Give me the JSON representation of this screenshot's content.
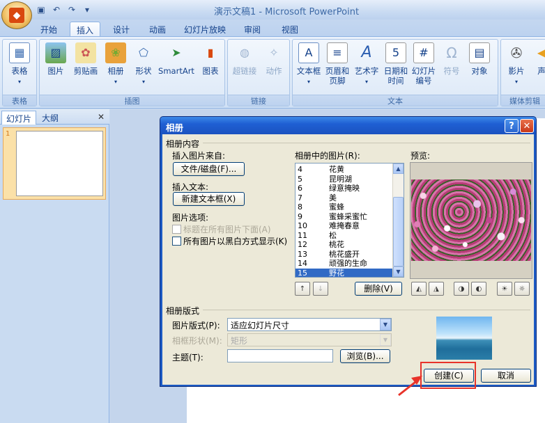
{
  "window": {
    "title": "演示文稿1 - Microsoft PowerPoint"
  },
  "quick_access": {
    "save_icon": "save-icon",
    "undo_icon": "undo-icon",
    "redo_icon": "redo-icon"
  },
  "ribbon_tabs": [
    "开始",
    "插入",
    "设计",
    "动画",
    "幻灯片放映",
    "审阅",
    "视图"
  ],
  "active_tab": "插入",
  "ribbon": {
    "groups": {
      "table": "表格",
      "illustrations": "插图",
      "links": "链接",
      "text": "文本",
      "media": "媒体剪辑"
    },
    "buttons": {
      "table": "表格",
      "picture": "图片",
      "clipart": "剪贴画",
      "album": "相册",
      "shapes": "形状",
      "smartart": "SmartArt",
      "chart": "图表",
      "hyperlink": "超链接",
      "action": "动作",
      "textbox": "文本框",
      "header_footer_1": "页眉和",
      "header_footer_2": "页脚",
      "wordart": "艺术字",
      "datetime_1": "日期和",
      "datetime_2": "时间",
      "slide_num_1": "幻灯片",
      "slide_num_2": "编号",
      "symbol": "符号",
      "object": "对象",
      "movie": "影片",
      "sound": "声"
    }
  },
  "panel_tabs": {
    "slides": "幻灯片",
    "outline": "大纲",
    "close": "✕"
  },
  "slide_thumb": {
    "number": "1"
  },
  "dialog": {
    "title": "相册",
    "help": "?",
    "close": "✕",
    "content_section": "相册内容",
    "insert_from_label": "插入图片来自:",
    "file_disk_button": "文件/磁盘(F)...",
    "insert_text_label": "插入文本:",
    "new_textbox_button": "新建文本框(X)",
    "picture_options_label": "图片选项:",
    "captions_below": "标题在所有图片下面(A)",
    "all_bw": "所有图片以黑白方式显示(K)",
    "pictures_in_album_label": "相册中的图片(R):",
    "pictures": [
      {
        "num": "4",
        "name": "花黄"
      },
      {
        "num": "5",
        "name": "昆明湖"
      },
      {
        "num": "6",
        "name": "绿意掩映"
      },
      {
        "num": "7",
        "name": "美"
      },
      {
        "num": "8",
        "name": "蜜蜂"
      },
      {
        "num": "9",
        "name": "蜜蜂采蜜忙"
      },
      {
        "num": "10",
        "name": "难掩春意"
      },
      {
        "num": "11",
        "name": "松"
      },
      {
        "num": "12",
        "name": "桃花"
      },
      {
        "num": "13",
        "name": "桃花盛开"
      },
      {
        "num": "14",
        "name": "顽强的生命"
      },
      {
        "num": "15",
        "name": "野花"
      }
    ],
    "selected_picture": "15",
    "remove_button": "删除(V)",
    "preview_label": "预览:",
    "layout_section": "相册版式",
    "picture_layout_label": "图片版式(P):",
    "picture_layout_value": "适应幻灯片尺寸",
    "frame_shape_label": "相框形状(M):",
    "frame_shape_value": "矩形",
    "theme_label": "主题(T):",
    "theme_value": "",
    "browse_button": "浏览(B)...",
    "create_button": "创建(C)",
    "cancel_button": "取消"
  },
  "colors": {
    "highlight": "#e8332a",
    "selection": "#316ac5",
    "title_bar": "#1f5fd3"
  }
}
